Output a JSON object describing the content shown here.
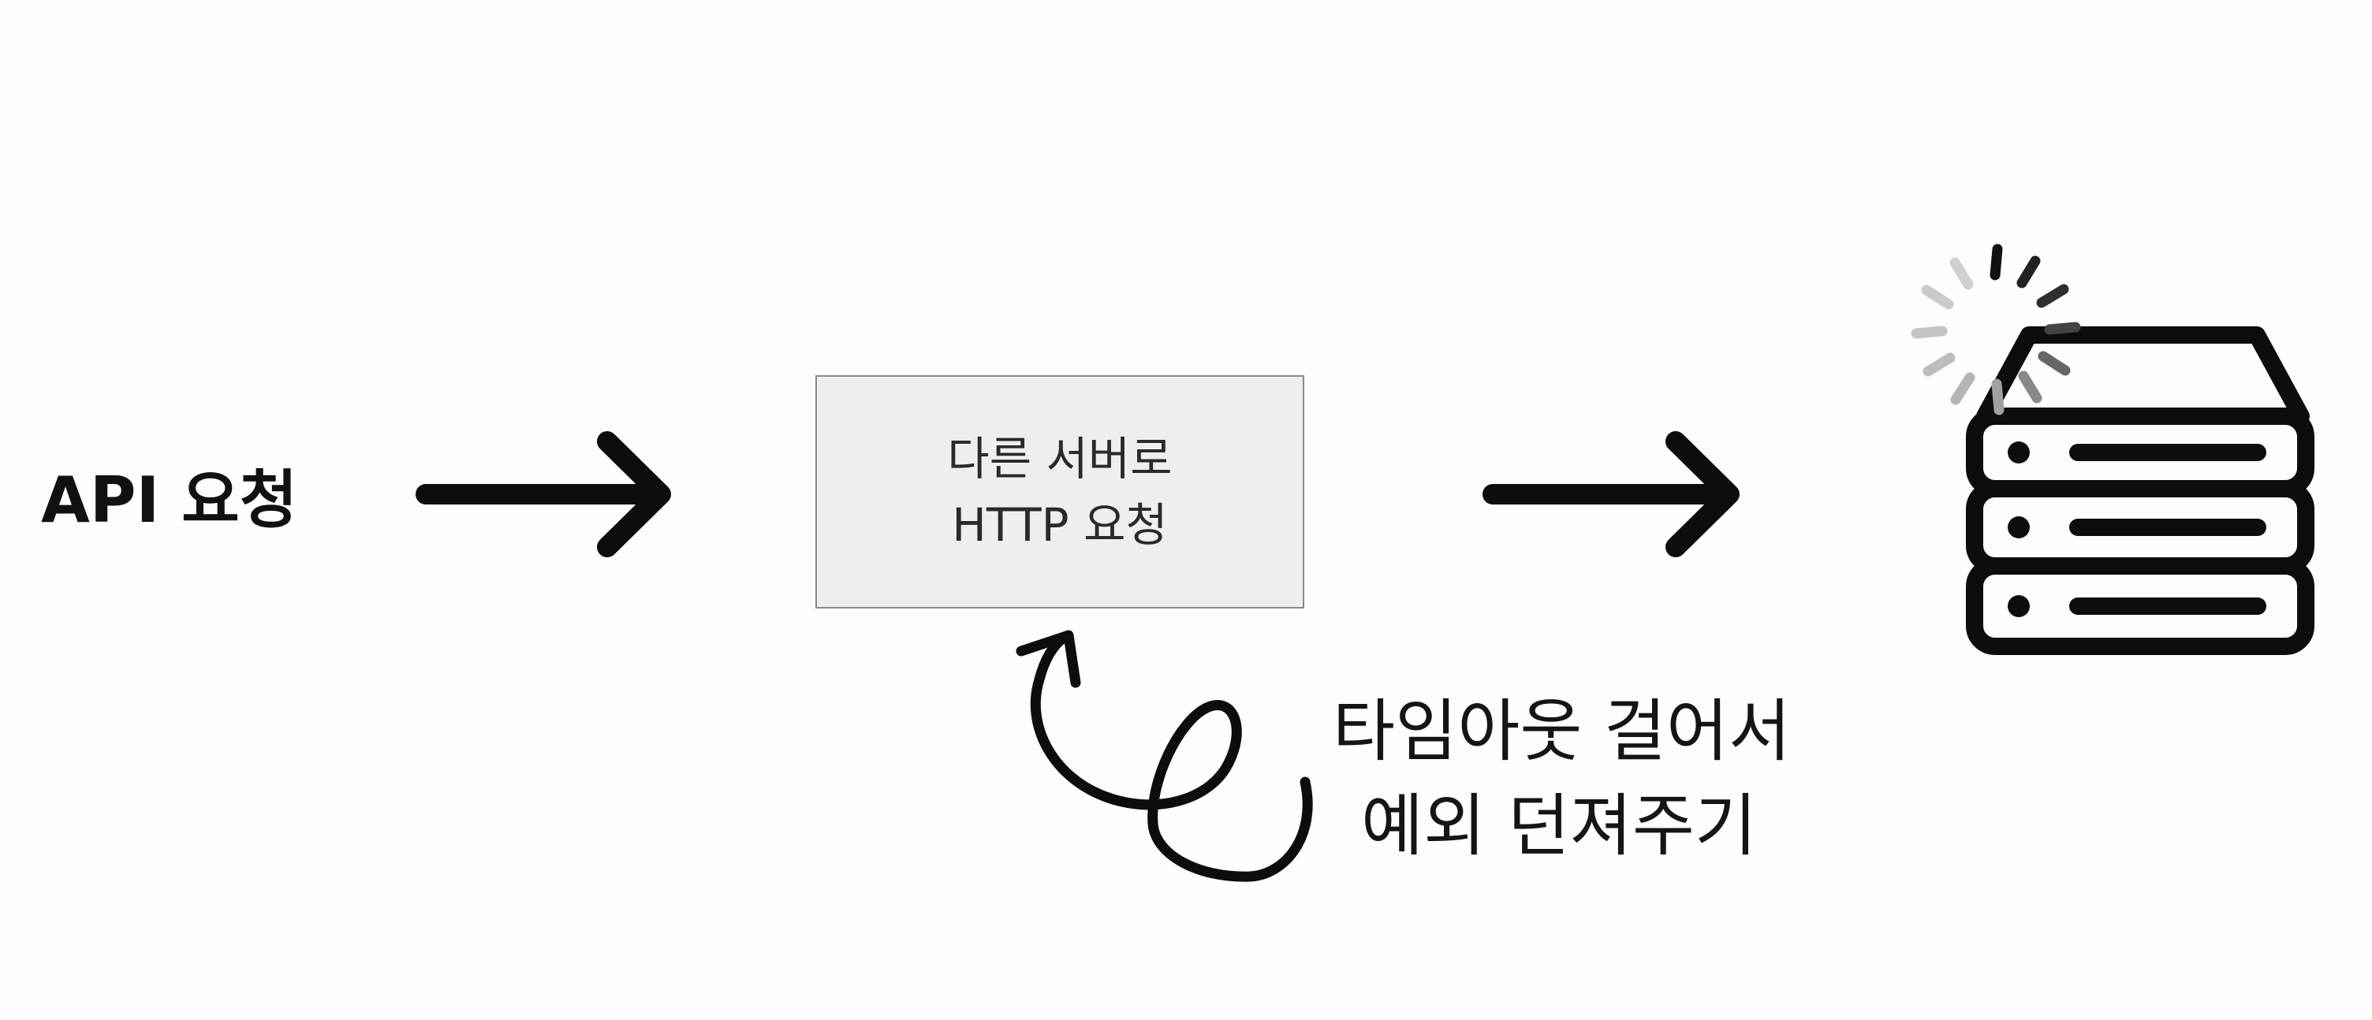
{
  "diagram": {
    "api_request_label": "API 요청",
    "request_box": {
      "line1": "다른 서버로",
      "line2": "HTTP 요청"
    },
    "timeout_note": {
      "line1": "타임아웃 걸어서",
      "line2": "예외 던져주기"
    },
    "icons": [
      "arrow-right-icon",
      "arrow-right-icon",
      "loop-arrow-icon",
      "server-icon",
      "loading-spinner-icon"
    ],
    "colors": {
      "ink": "#111111",
      "box_fill": "#eeeeee",
      "box_border": "#8a8a8a",
      "spinner_light": "#c8c8c8",
      "spinner_dark": "#111111"
    }
  }
}
